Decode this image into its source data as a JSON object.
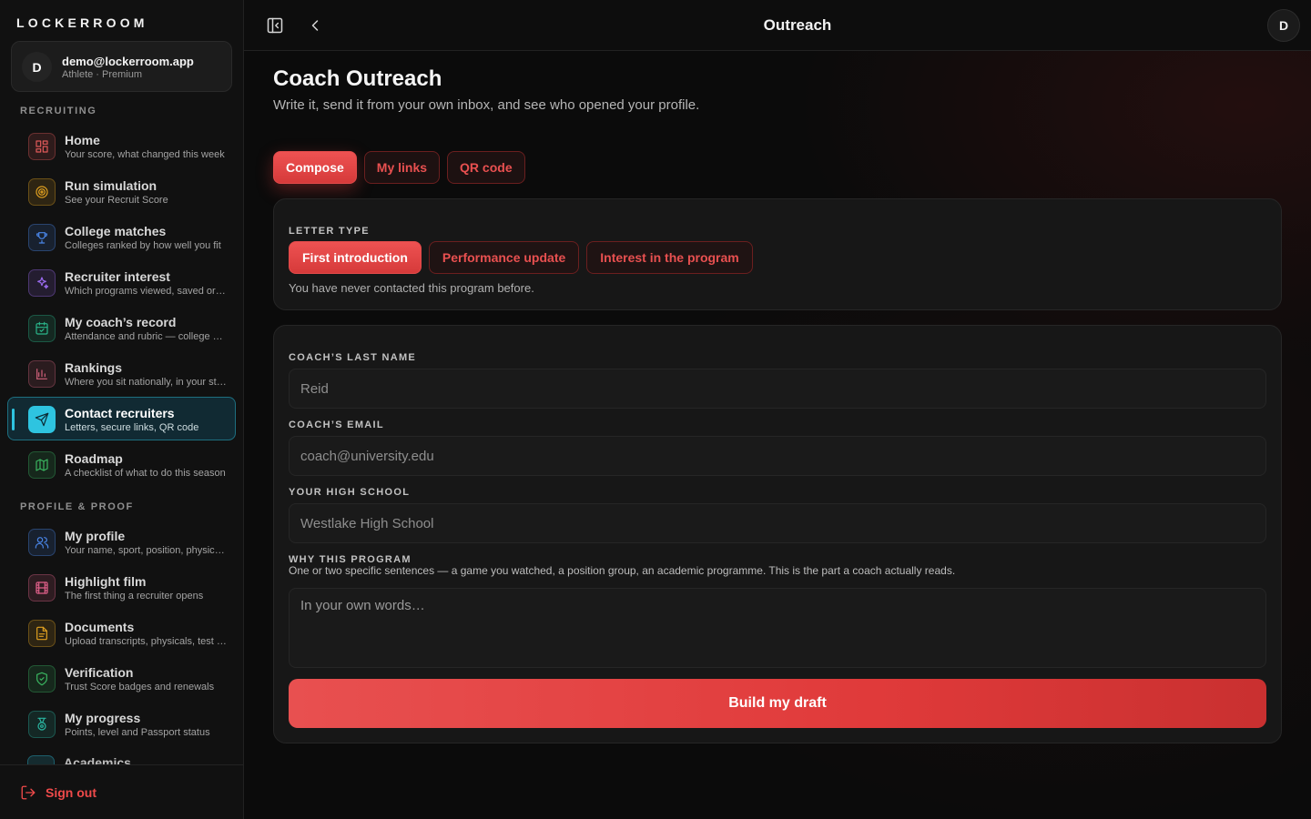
{
  "brand": "LOCKERROOM",
  "account": {
    "avatar": "D",
    "email": "demo@lockerroom.app",
    "role": "Athlete · Premium"
  },
  "sidebar": {
    "recruiting_label": "RECRUITING",
    "recruiting_items": [
      {
        "title": "Home",
        "sub": "Your score, what changed this week",
        "icon": "dashboard-icon",
        "color": "#e05a5a"
      },
      {
        "title": "Run simulation",
        "sub": "See your Recruit Score",
        "icon": "target-icon",
        "color": "#e0a020"
      },
      {
        "title": "College matches",
        "sub": "Colleges ranked by how well you fit",
        "icon": "trophy-icon",
        "color": "#4a86e8"
      },
      {
        "title": "Recruiter interest",
        "sub": "Which programs viewed, saved or contacted you",
        "icon": "sparkles-icon",
        "color": "#9b6bef"
      },
      {
        "title": "My coach’s record",
        "sub": "Attendance and rubric — college coaches see this",
        "icon": "calendar-check-icon",
        "color": "#2ab58a"
      },
      {
        "title": "Rankings",
        "sub": "Where you sit nationally, in your state",
        "icon": "bar-chart-icon",
        "color": "#d0607a"
      },
      {
        "title": "Contact recruiters",
        "sub": "Letters, secure links, QR code",
        "icon": "send-icon",
        "color": "#2ec4e0",
        "active": true
      },
      {
        "title": "Roadmap",
        "sub": "A checklist of what to do this season",
        "icon": "map-icon",
        "color": "#3ab560"
      }
    ],
    "profile_label": "PROFILE & PROOF",
    "profile_items": [
      {
        "title": "My profile",
        "sub": "Your name, sport, position, physicals",
        "icon": "users-icon",
        "color": "#4a86e8"
      },
      {
        "title": "Highlight film",
        "sub": "The first thing a recruiter opens",
        "icon": "film-icon",
        "color": "#e0608a"
      },
      {
        "title": "Documents",
        "sub": "Upload transcripts, physicals, test scores",
        "icon": "document-icon",
        "color": "#e0a020"
      },
      {
        "title": "Verification",
        "sub": "Trust Score badges and renewals",
        "icon": "shield-check-icon",
        "color": "#3ab560"
      },
      {
        "title": "My progress",
        "sub": "Points, level and Passport status",
        "icon": "medal-icon",
        "color": "#2ab5a0"
      }
    ],
    "clipped_item": "Academics",
    "signout": "Sign out"
  },
  "topbar": {
    "title": "Outreach",
    "avatar": "D"
  },
  "page": {
    "title": "Coach Outreach",
    "subtitle": "Write it, send it from your own inbox, and see who opened your profile.",
    "tabs": [
      {
        "label": "Compose",
        "active": true
      },
      {
        "label": "My links",
        "active": false
      },
      {
        "label": "QR code",
        "active": false
      }
    ]
  },
  "letter_type": {
    "label": "LETTER TYPE",
    "options": [
      {
        "label": "First introduction",
        "active": true
      },
      {
        "label": "Performance update",
        "active": false
      },
      {
        "label": "Interest in the program",
        "active": false
      }
    ],
    "help": "You have never contacted this program before."
  },
  "form": {
    "coach_last_name": {
      "label": "COACH’S LAST NAME",
      "placeholder": "Reid"
    },
    "coach_email": {
      "label": "COACH’S EMAIL",
      "placeholder": "coach@university.edu"
    },
    "high_school": {
      "label": "YOUR HIGH SCHOOL",
      "placeholder": "Westlake High School"
    },
    "why_program": {
      "label": "WHY THIS PROGRAM",
      "help": "One or two specific sentences — a game you watched, a position group, an academic programme. This is the part a coach actually reads.",
      "placeholder": "In your own words…"
    },
    "submit": "Build my draft"
  }
}
